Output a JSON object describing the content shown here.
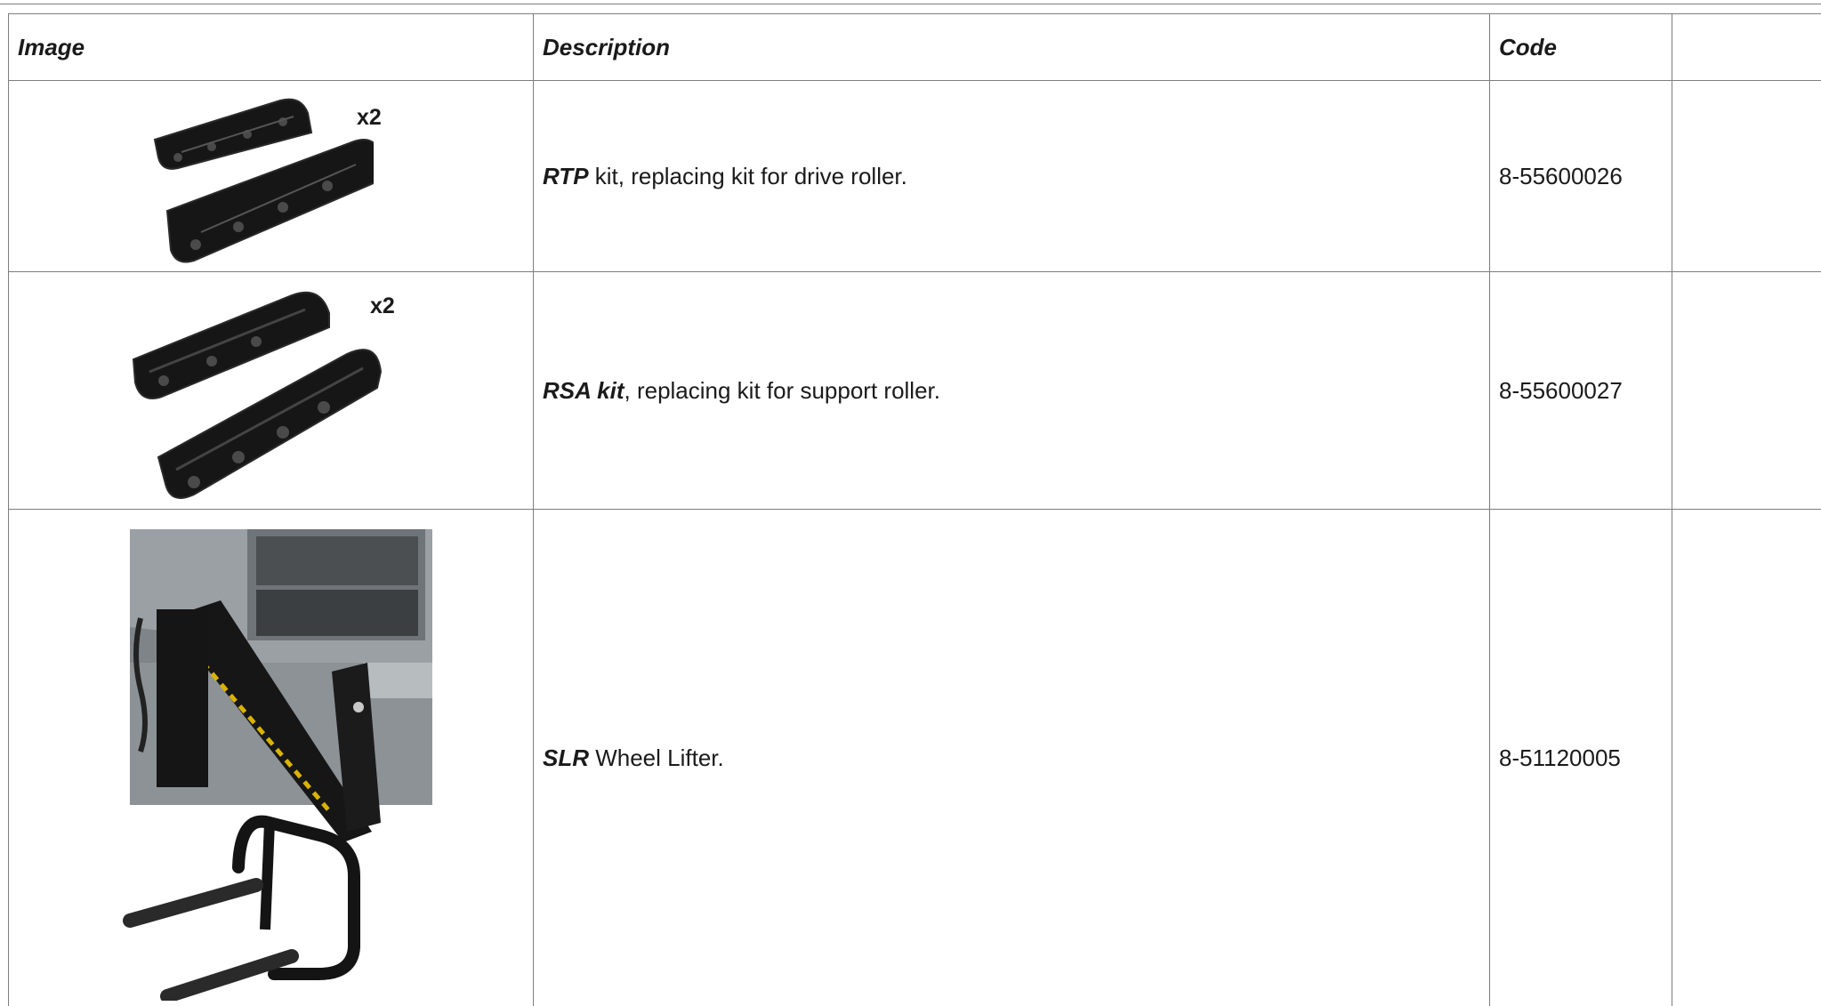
{
  "table": {
    "headers": {
      "image": "Image",
      "description": "Description",
      "code": "Code",
      "extra": ""
    },
    "rows": [
      {
        "image_label": "RTP replacing kit (two half-shell roller covers)",
        "qty": "x2",
        "name": "RTP",
        "desc_rest": " kit, replacing kit for drive roller.",
        "code": "8-55600026"
      },
      {
        "image_label": "RSA replacing kit (two half-shell roller covers)",
        "qty": "x2",
        "name": "RSA kit",
        "desc_rest": ", replacing kit for support roller.",
        "code": "8-55600027"
      },
      {
        "image_label": "SLR wheel lifter mounted on machine",
        "name": "SLR",
        "desc_rest": " Wheel Lifter.",
        "code": "8-51120005"
      }
    ]
  },
  "colors": {
    "grid": "#7d7d7d",
    "part": "#161616",
    "machine": "#9aa0a4"
  }
}
